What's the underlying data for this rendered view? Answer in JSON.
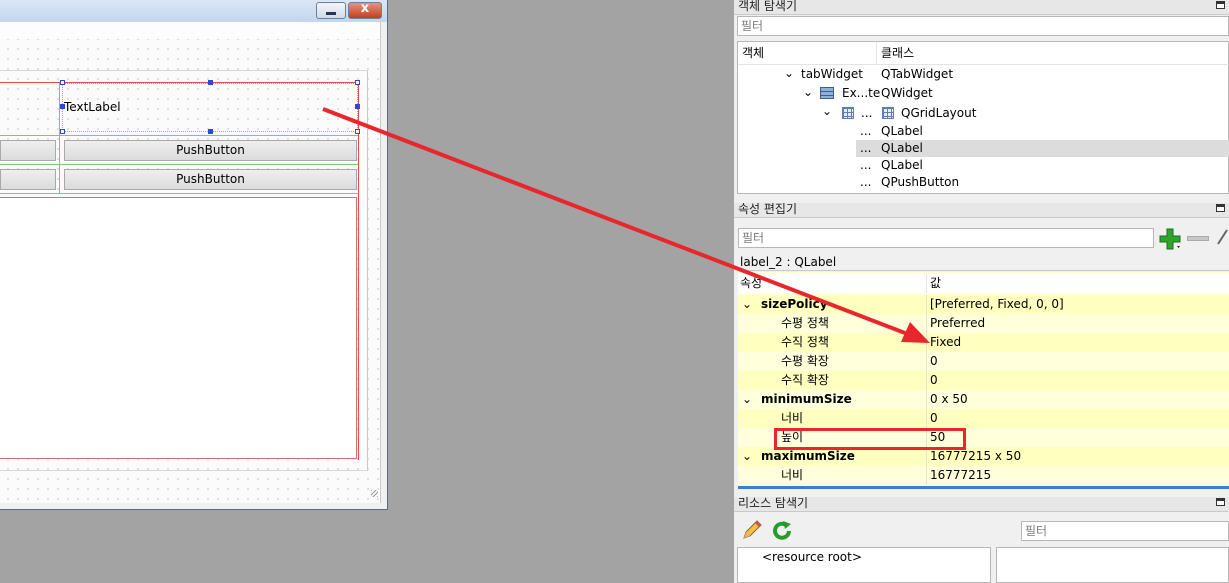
{
  "object_inspector": {
    "title": "객체 탐색기",
    "filter_placeholder": "필터",
    "col_object": "객체",
    "col_class": "클래스",
    "rows": [
      {
        "object": "tabWidget",
        "class": "QTabWidget"
      },
      {
        "object": "Ex...te",
        "class": "QWidget"
      },
      {
        "object": "...",
        "class": "QGridLayout"
      },
      {
        "object": "...",
        "class": "QLabel"
      },
      {
        "object": "...",
        "class": "QLabel"
      },
      {
        "object": "...",
        "class": "QLabel"
      },
      {
        "object": "...",
        "class": "QPushButton"
      }
    ]
  },
  "property_editor": {
    "title": "속성 편집기",
    "filter_placeholder": "필터",
    "object_label": "label_2 : QLabel",
    "col_property": "속성",
    "col_value": "값",
    "rows": [
      {
        "name": "sizePolicy",
        "value": "[Preferred, Fixed, 0, 0]"
      },
      {
        "name": "수평 정책",
        "value": "Preferred"
      },
      {
        "name": "수직 정책",
        "value": "Fixed"
      },
      {
        "name": "수평 확장",
        "value": "0"
      },
      {
        "name": "수직 확장",
        "value": "0"
      },
      {
        "name": "minimumSize",
        "value": "0 x 50"
      },
      {
        "name": "너비",
        "value": "0"
      },
      {
        "name": "높이",
        "value": "50"
      },
      {
        "name": "maximumSize",
        "value": "16777215 x 50"
      },
      {
        "name": "너비",
        "value": "16777215"
      }
    ]
  },
  "resource_browser": {
    "title": "리소스 탐색기",
    "filter_placeholder": "필터",
    "root_item": "<resource root>"
  },
  "form": {
    "text_label": "TextLabel",
    "button_1": "PushButton",
    "button_2": "PushButton",
    "close_glyph": "x"
  },
  "colors": {
    "annotation_red": "#e8262b",
    "property_row_yellow": "#ffffdc",
    "property_group_yellow": "#ffffbf",
    "selection_gray": "#dcdcdc"
  },
  "icons": {
    "edit": "pencil-icon",
    "reload": "reload-icon",
    "add": "plus-icon",
    "remove": "minus-icon"
  }
}
